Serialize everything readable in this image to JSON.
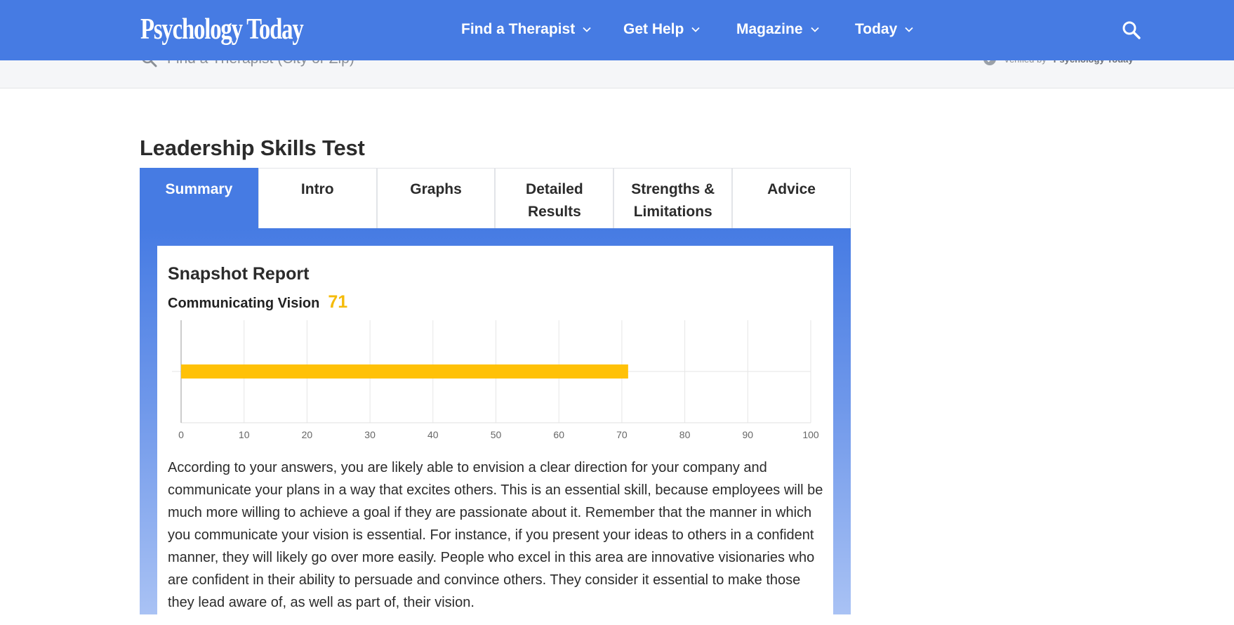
{
  "nav": {
    "logo": "Psychology Today",
    "items": [
      {
        "label": "Find a Therapist"
      },
      {
        "label": "Get Help"
      },
      {
        "label": "Magazine"
      },
      {
        "label": "Today"
      }
    ]
  },
  "strip": {
    "search_placeholder": "Find a Therapist (City or Zip)",
    "verified_prefix": "Verified by",
    "verified_brand": "Psychology Today"
  },
  "page": {
    "title": "Leadership Skills Test"
  },
  "tabs": [
    {
      "label": "Summary",
      "active": true
    },
    {
      "label": "Intro",
      "active": false
    },
    {
      "label": "Graphs",
      "active": false
    },
    {
      "label": "Detailed Results",
      "active": false
    },
    {
      "label": "Strengths & Limitations",
      "active": false
    },
    {
      "label": "Advice",
      "active": false
    }
  ],
  "report": {
    "title": "Snapshot Report",
    "score_label": "Communicating Vision",
    "score_value": "71",
    "description": "According to your answers, you are likely able to envision a clear direction for your company and communicate your plans in a way that excites others. This is an essential skill, because employees will be much more willing to achieve a goal if they are passionate about it. Remember that the manner in which you communicate your vision is essential. For instance, if you present your ideas to others in a confident manner, they will likely go over more easily. People who excel in this area are innovative visionaries who are confident in their ability to persuade and convince others. They consider it essential to make those they lead aware of, as well as part of, their vision."
  },
  "colors": {
    "brand_blue": "#467be3",
    "bar_yellow": "#ffc107",
    "score_yellow": "#f5bb0a"
  },
  "chart_data": {
    "type": "bar",
    "orientation": "horizontal",
    "values": [
      71
    ],
    "xlim": [
      0,
      100
    ],
    "xticks": [
      0,
      10,
      20,
      30,
      40,
      50,
      60,
      70,
      80,
      90,
      100
    ],
    "grid": true
  }
}
